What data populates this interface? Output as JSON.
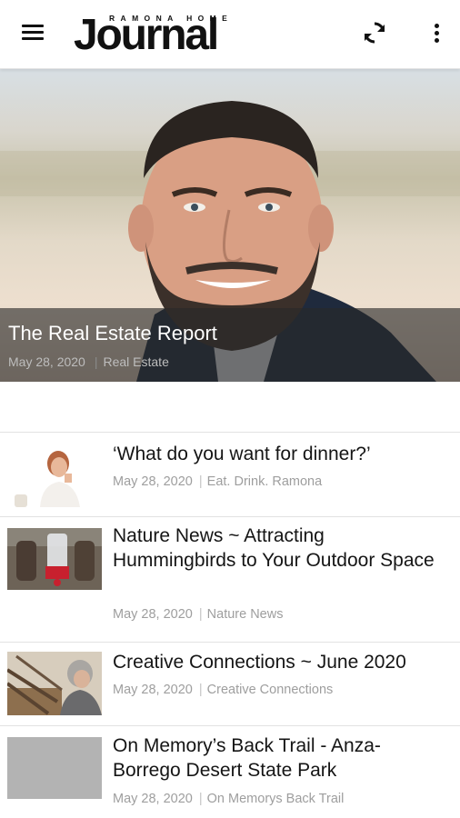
{
  "appbar": {
    "logo_top": "RAMONA HOME",
    "logo_main": "Journal",
    "icons": [
      "menu-icon",
      "refresh-icon",
      "more-vert-icon"
    ]
  },
  "hero": {
    "title": "The Real Estate Report",
    "date": "May 28, 2020",
    "category": "Real Estate"
  },
  "articles": [
    {
      "title": "‘What do you want for dinner?’",
      "date": "May 28, 2020",
      "category": "Eat. Drink. Ramona"
    },
    {
      "title": "Nature News ~ Attracting Hummingbirds to Your Outdoor Space",
      "date": "May 28, 2020",
      "category": "Nature News"
    },
    {
      "title": "Creative Connections ~ June 2020",
      "date": "May 28, 2020",
      "category": "Creative Connections"
    },
    {
      "title": "On Memory’s Back Trail - Anza-Borrego Desert State Park",
      "date": "May 28, 2020",
      "category": "On Memorys Back Trail"
    }
  ],
  "colors": {
    "background": "#ffffff",
    "text": "#151515",
    "meta_text": "#9e9e9e",
    "divider": "#e2e2e2",
    "hero_overlay": "rgba(40,40,40,0.62)",
    "placeholder_thumb": "#b3b3b3"
  }
}
